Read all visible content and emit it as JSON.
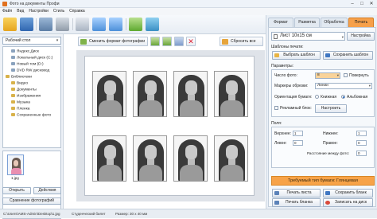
{
  "window": {
    "title": "Фото на документы Профи"
  },
  "menu": [
    "Файл",
    "Вид",
    "Настройки",
    "Стиль",
    "Справка"
  ],
  "left_panel": {
    "folder_combo": "Рабочий стол",
    "tree": [
      "Яндекс.Диск",
      "Локальный диск (C:)",
      "Новый том (D:)",
      "DVD RW дисковод",
      "Библиотеки",
      "Видео",
      "Документы",
      "Изображения",
      "Музыка",
      "Пленка",
      "Сохраненные фото"
    ],
    "thumbnail_caption": "1.jpg",
    "open_button": "Открыть",
    "action_button": "Действия",
    "compare_button": "Сравнение фотографий"
  },
  "center_toolbar": {
    "change_format": "Сменить формат фотографии",
    "reset_all": "Сбросить все"
  },
  "tabs": [
    "Формат",
    "Разметка",
    "Обработка",
    "Печать"
  ],
  "active_tab": "Печать",
  "print_panel": {
    "paper_size": "Лист 10х15 см",
    "settings_button": "Настройка",
    "templates_label": "Шаблоны печати:",
    "choose_template": "Выбрать шаблон",
    "save_template": "Сохранить шаблон",
    "params_label": "Параметры:",
    "photo_count_label": "Число фото:",
    "photo_count": "8",
    "rotate_label": "Повернуть",
    "cut_markers_label": "Маркеры обрезки:",
    "cut_markers": "Линии",
    "orientation_label": "Ориентация бумаги:",
    "orientation_portrait": "Книжная",
    "orientation_landscape": "Альбомная",
    "ad_block_label": "Рекламный блок:",
    "ad_block_settings": "Настроить",
    "margins_label": "Поля:",
    "top_label": "Верхнее:",
    "top_value": "1",
    "bottom_label": "Нижнее:",
    "bottom_value": "1",
    "left_label": "Левое:",
    "left_value": "0",
    "right_label": "Правое:",
    "right_value": "0",
    "spacing_label": "Расстояние между фото:",
    "spacing_value": "0",
    "paper_type_banner": "Требуемый тип бумаги: Глянцевая",
    "print_sheet": "Печать листа",
    "save_blank": "Сохранить бланк",
    "print_dialog": "Печать бланка",
    "record_disk": "Записать на диск"
  },
  "status": {
    "path": "C:\\Users\\AMS-Admin\\Desktop\\1.jpg",
    "type": "Студенческий билет",
    "size": "Размер: 30 x 40 мм"
  },
  "colors": {
    "accent": "#f6a04a",
    "panel": "#e9eff6"
  }
}
